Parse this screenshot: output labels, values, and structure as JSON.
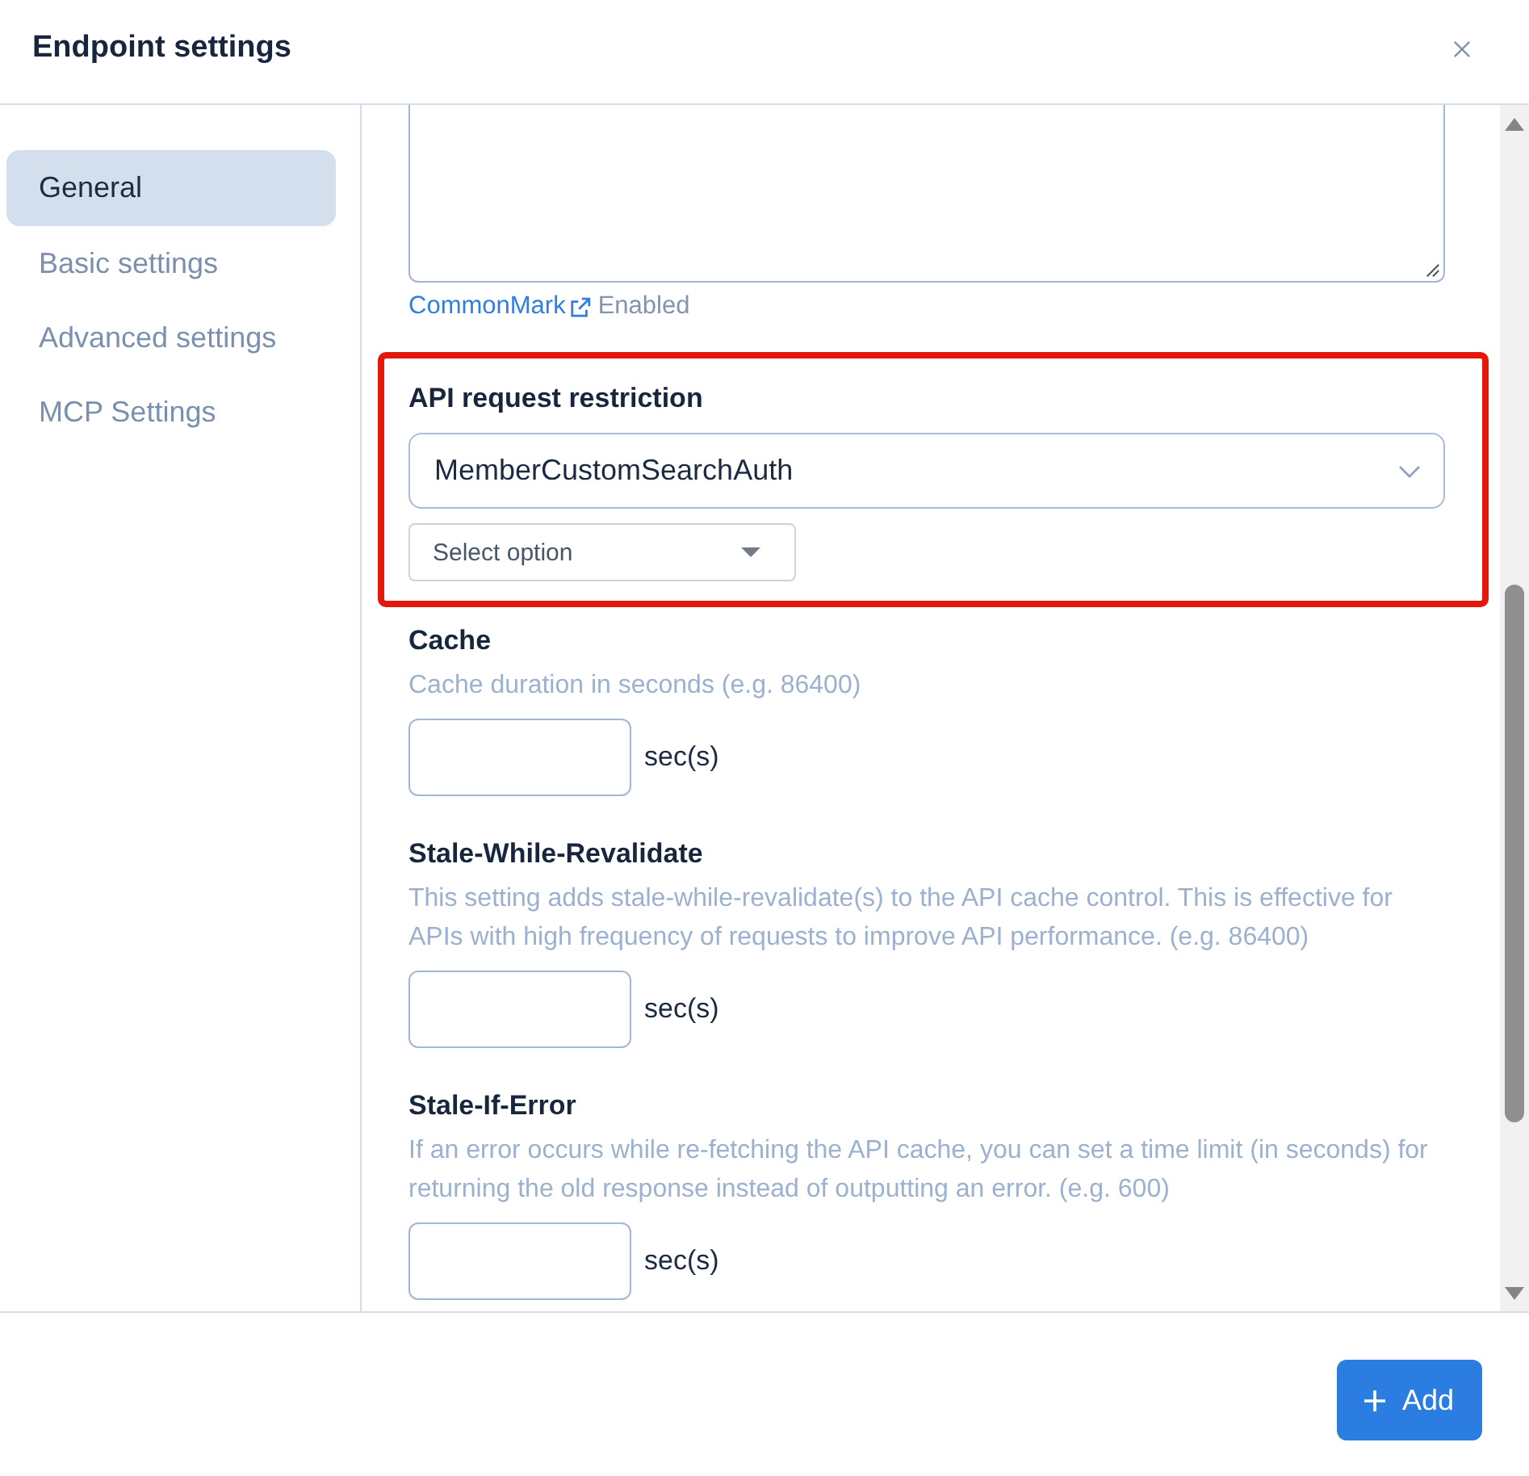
{
  "window": {
    "title": "Endpoint settings"
  },
  "sidebar": {
    "items": [
      {
        "label": "General",
        "selected": true
      },
      {
        "label": "Basic settings",
        "selected": false
      },
      {
        "label": "Advanced settings",
        "selected": false
      },
      {
        "label": "MCP Settings",
        "selected": false
      }
    ]
  },
  "form": {
    "sections": [
      {
        "kind": "textarea",
        "highlighted": false,
        "note": {
          "link": "CommonMark",
          "status": "Enabled"
        }
      },
      {
        "kind": "select_group",
        "highlighted": true,
        "label": "API request restriction",
        "select": {
          "value": "MemberCustomSearchAuth"
        },
        "sub_select": {
          "placeholder": "Select option"
        }
      },
      {
        "kind": "duration",
        "highlighted": false,
        "label": "Cache",
        "hint": "Cache duration in seconds (e.g. 86400)",
        "unit": "sec(s)"
      },
      {
        "kind": "duration",
        "highlighted": false,
        "label": "Stale-While-Revalidate",
        "hint": "This setting adds stale-while-revalidate(s) to the API cache control. This is effective for APIs with high frequency of requests to improve API performance. (e.g. 86400)",
        "unit": "sec(s)"
      },
      {
        "kind": "duration",
        "highlighted": false,
        "label": "Stale-If-Error",
        "hint": "If an error occurs while re-fetching the API cache, you can set a time limit (in seconds) for returning the old response instead of outputting an error. (e.g. 600)",
        "unit": "sec(s)"
      }
    ]
  },
  "footer": {
    "buttons": [
      {
        "label": "Add",
        "kind": "primary"
      }
    ]
  }
}
